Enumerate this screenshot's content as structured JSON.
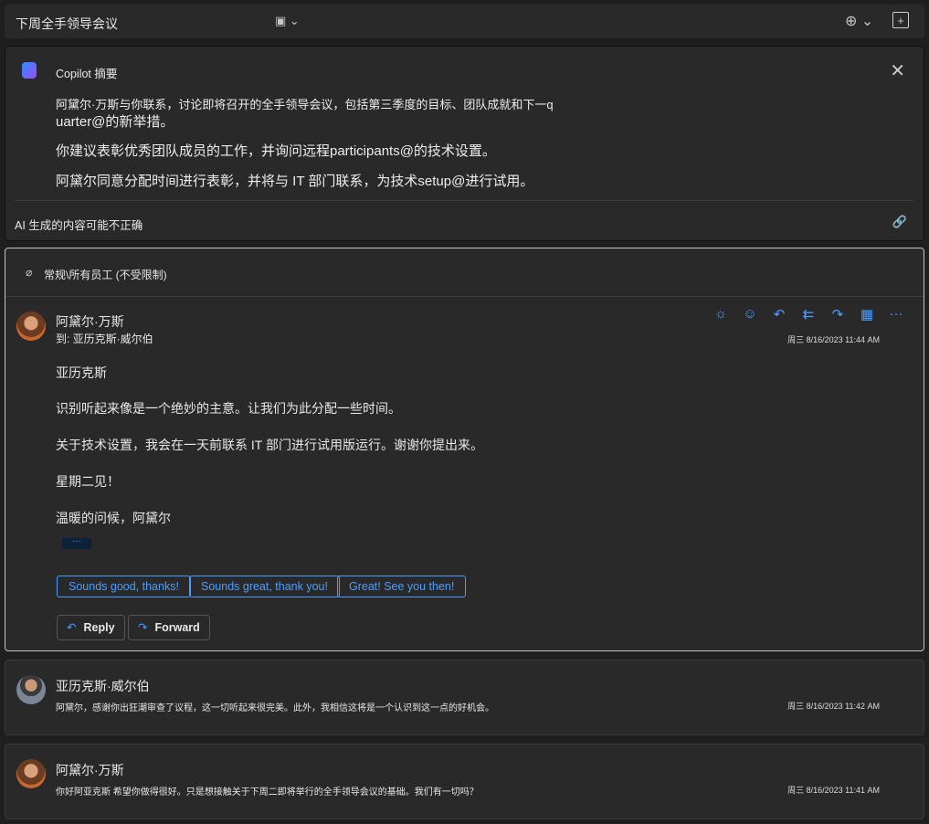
{
  "header": {
    "title": "下周全手领导会议"
  },
  "copilot": {
    "title": "Copilot 摘要",
    "lines": [
      "阿黛尔·万斯与你联系，讨论即将召开的全手领导会议，包括第三季度的目标、团队成就和下一q",
      "uarter@的新举措。",
      "你建议表彰优秀团队成员的工作，并询问远程participants@的技术设置。",
      "阿黛尔同意分配时间进行表彰，并将与 IT 部门联系，为技术setup@进行试用。"
    ],
    "disclaimer": "AI 生成的内容可能不正确"
  },
  "thread": {
    "label": "常规\\所有员工 (不受限制)"
  },
  "messages": [
    {
      "sender": "阿黛尔·万斯",
      "to": "到:  亚历克斯·威尔伯",
      "date": "周三 8/16/2023 11:44 AM",
      "body": [
        "亚历克斯",
        "识别听起来像是一个绝妙的主意。让我们为此分配一些时间。",
        "关于技术设置，我会在一天前联系 IT 部门进行试用版运行。谢谢你提出来。",
        "星期二见！",
        "温暖的问候，阿黛尔"
      ],
      "suggestions": [
        "Sounds good, thanks!",
        "Sounds great, thank you!",
        "Great! See you then!"
      ],
      "reply": "Reply",
      "forward": "Forward",
      "more": "···"
    },
    {
      "sender": "亚历克斯·威尔伯",
      "preview": "阿黛尔，感谢你出狂潮审查了议程，这一切听起来很完美。此外，我相信这将是一个认识到这一点的好机会。",
      "date": "周三 8/16/2023 11:42 AM"
    },
    {
      "sender": "阿黛尔·万斯",
      "preview": "你好阿亚克斯 希望你做得很好。只是想接触关于下周二即将举行的全手领导会议的基础。我们有一切吗？",
      "date": "周三 8/16/2023 11:41 AM"
    }
  ]
}
